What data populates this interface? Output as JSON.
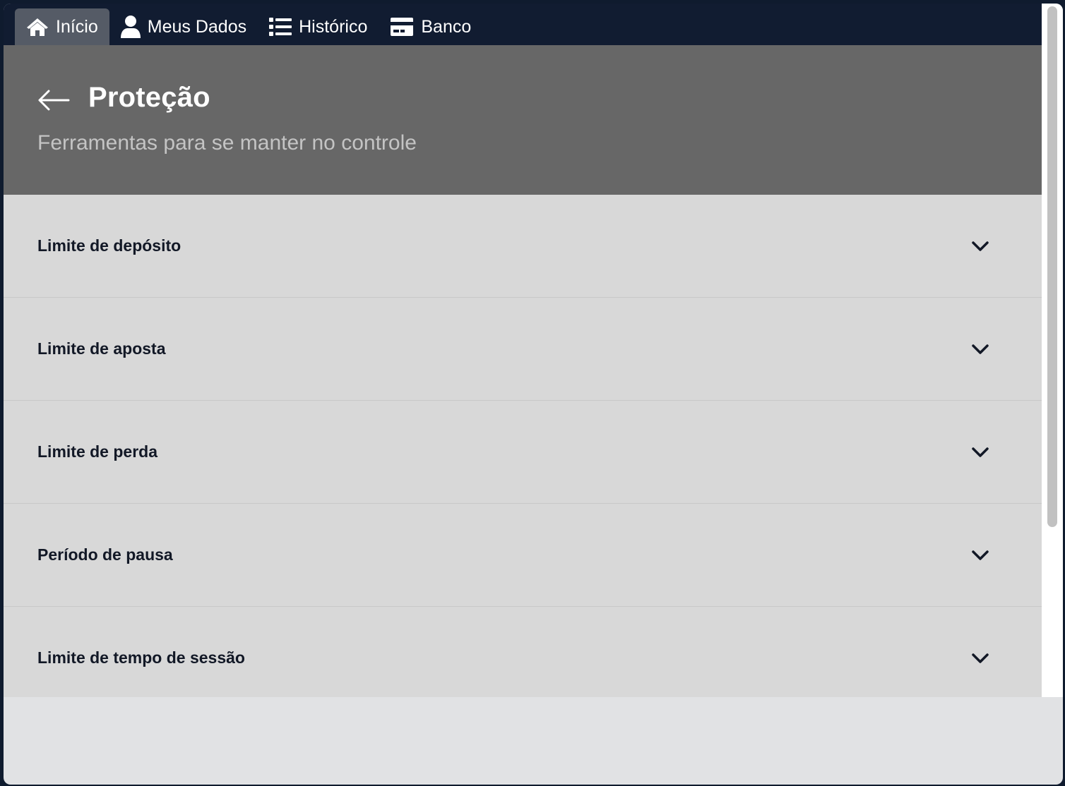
{
  "nav": {
    "tabs": [
      {
        "label": "Início",
        "icon": "home-icon",
        "active": true
      },
      {
        "label": "Meus Dados",
        "icon": "user-icon",
        "active": false
      },
      {
        "label": "Histórico",
        "icon": "list-icon",
        "active": false
      },
      {
        "label": "Banco",
        "icon": "credit-card-icon",
        "active": false
      }
    ]
  },
  "header": {
    "back_icon": "arrow-left-icon",
    "title": "Proteção",
    "subtitle": "Ferramentas para se manter no controle"
  },
  "items": [
    {
      "label": "Limite de depósito",
      "icon": "chevron-down-icon"
    },
    {
      "label": "Limite de aposta",
      "icon": "chevron-down-icon"
    },
    {
      "label": "Limite de perda",
      "icon": "chevron-down-icon"
    },
    {
      "label": "Período de pausa",
      "icon": "chevron-down-icon"
    },
    {
      "label": "Limite de tempo de sessão",
      "icon": "chevron-down-icon"
    }
  ],
  "colors": {
    "nav_bg": "#111c31",
    "active_tab_bg": "#555b66",
    "hero_bg": "#676767",
    "list_bg": "#d8d8d8",
    "page_bg": "#e1e2e4"
  }
}
